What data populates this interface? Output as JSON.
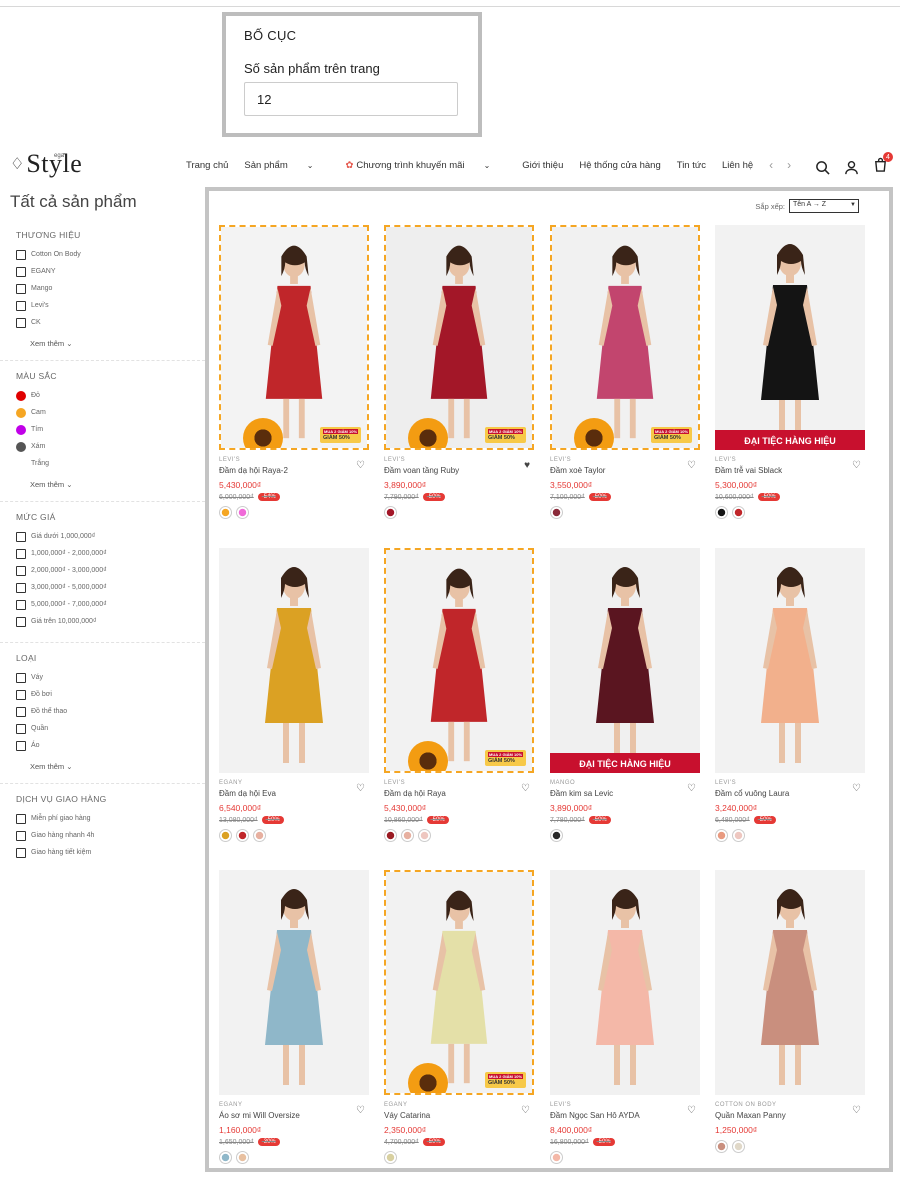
{
  "layout_panel": {
    "title": "BỐ CỤC",
    "label": "Số sản phẩm trên trang",
    "value": "12"
  },
  "header": {
    "logo_small": "ega",
    "logo_text": "Style",
    "nav": [
      "Trang chủ",
      "Sản phẩm",
      "Chương trình khuyến mãi",
      "Giới thiệu",
      "Hệ thống cửa hàng",
      "Tin tức",
      "Liên hệ"
    ],
    "cart_count": "4"
  },
  "sidebar": {
    "title": "Tất cả sản phẩm",
    "brand": {
      "title": "THƯƠNG HIỆU",
      "items": [
        "Cotton On Body",
        "EGANY",
        "Mango",
        "Levi's",
        "CK"
      ],
      "more": "Xem thêm"
    },
    "color": {
      "title": "MÀU SẮC",
      "items": [
        {
          "label": "Đỏ",
          "color": "#e00000"
        },
        {
          "label": "Cam",
          "color": "#f5a623"
        },
        {
          "label": "Tím",
          "color": "#c000e8"
        },
        {
          "label": "Xám",
          "color": "#555555"
        },
        {
          "label": "Trắng",
          "color": "#ffffff"
        }
      ],
      "more": "Xem thêm"
    },
    "price": {
      "title": "MỨC GIÁ",
      "items": [
        "Giá dưới 1,000,000₫",
        "1,000,000₫ - 2,000,000₫",
        "2,000,000₫ - 3,000,000₫",
        "3,000,000₫ - 5,000,000₫",
        "5,000,000₫ - 7,000,000₫",
        "Giá trên 10,000,000₫"
      ]
    },
    "type": {
      "title": "LOẠI",
      "items": [
        "Váy",
        "Đồ bơi",
        "Đồ thể thao",
        "Quần",
        "Áo"
      ],
      "more": "Xem thêm"
    },
    "delivery": {
      "title": "DỊCH VỤ GIAO HÀNG",
      "items": [
        "Miễn phí giao hàng",
        "Giao hàng nhanh 4h",
        "Giao hàng tiết kiệm"
      ]
    }
  },
  "sort": {
    "label": "Sắp xếp:",
    "value": "Tên A → Z"
  },
  "promo": {
    "ribbon": "ĐẠI TIỆC HÀNG HIỆU",
    "badge": "GIẢM 50%",
    "badge_small": "MUA 2 GIẢM 10%"
  },
  "products": [
    {
      "brand": "LEVI'S",
      "name": "Đầm dạ hội Raya-2",
      "price": "5,430,000₫",
      "old": "6,000,000₫",
      "disc": "-54%",
      "dress": "#c0262a",
      "bg": "#f3f3f3",
      "swatches": [
        "#f5a623",
        "#f06ad8"
      ]
    },
    {
      "brand": "LEVI'S",
      "name": "Đầm voan tầng Ruby",
      "price": "3,890,000₫",
      "old": "7,790,000₫",
      "disc": "-50%",
      "dress": "#a31728",
      "bg": "#eeeeee",
      "swatches": [
        "#a31728"
      ]
    },
    {
      "brand": "LEVI'S",
      "name": "Đầm xoè Taylor",
      "price": "3,550,000₫",
      "old": "7,100,000₫",
      "disc": "-50%",
      "dress": "#c2456e",
      "bg": "#f1f1f1",
      "swatches": [
        "#8a2a3a"
      ]
    },
    {
      "brand": "LEVI'S",
      "name": "Đầm trễ vai Sblack",
      "price": "5,300,000₫",
      "old": "10,600,000₫",
      "disc": "-50%",
      "dress": "#141414",
      "bg": "#f2f2f2",
      "swatches": [
        "#141414",
        "#c0262a"
      ]
    },
    {
      "brand": "EGANY",
      "name": "Đầm dạ hội Eva",
      "price": "6,540,000₫",
      "old": "13,080,000₫",
      "disc": "-50%",
      "dress": "#dba123",
      "bg": "#f2f2f2",
      "swatches": [
        "#dba123",
        "#c0262a",
        "#e7b0a0"
      ]
    },
    {
      "brand": "LEVI'S",
      "name": "Đầm dạ hội Raya",
      "price": "5,430,000₫",
      "old": "10,860,000₫",
      "disc": "-50%",
      "dress": "#c0262a",
      "bg": "#f2f2f2",
      "swatches": [
        "#9a1a22",
        "#e7b0a0",
        "#eec7c0"
      ]
    },
    {
      "brand": "MANGO",
      "name": "Đầm kim sa Levic",
      "price": "3,890,000₫",
      "old": "7,780,000₫",
      "disc": "-50%",
      "dress": "#5a1520",
      "bg": "#f0f0f0",
      "swatches": [
        "#2a2a2a"
      ]
    },
    {
      "brand": "LEVI'S",
      "name": "Đầm cổ vuông Laura",
      "price": "3,240,000₫",
      "old": "6,480,000₫",
      "disc": "-50%",
      "dress": "#f2b08c",
      "bg": "#f2f2f2",
      "swatches": [
        "#e89a80",
        "#eec7c0"
      ]
    },
    {
      "brand": "EGANY",
      "name": "Áo sơ mi Will Oversize",
      "price": "1,160,000₫",
      "old": "1,650,000₫",
      "disc": "-30%",
      "dress": "#8fb7c9",
      "bg": "#f2f2f2",
      "swatches": [
        "#8fb7c9",
        "#e8c0a0"
      ]
    },
    {
      "brand": "EGANY",
      "name": "Váy Catarina",
      "price": "2,350,000₫",
      "old": "4,700,000₫",
      "disc": "-50%",
      "dress": "#e4e0a8",
      "bg": "#f2f2f2",
      "swatches": [
        "#d8d0a0"
      ]
    },
    {
      "brand": "LEVI'S",
      "name": "Đầm Ngọc San Hô AYDA",
      "price": "8,400,000₫",
      "old": "16,800,000₫",
      "disc": "-50%",
      "dress": "#f4b8a8",
      "bg": "#f1f1f1",
      "swatches": [
        "#f4b8a8"
      ]
    },
    {
      "brand": "COTTON ON BODY",
      "name": "Quần Maxan Panny",
      "price": "1,250,000₫",
      "old": "",
      "disc": "",
      "dress": "#c98f7e",
      "bg": "#f2f2f2",
      "swatches": [
        "#c98f7e",
        "#e0d8c8"
      ]
    }
  ]
}
